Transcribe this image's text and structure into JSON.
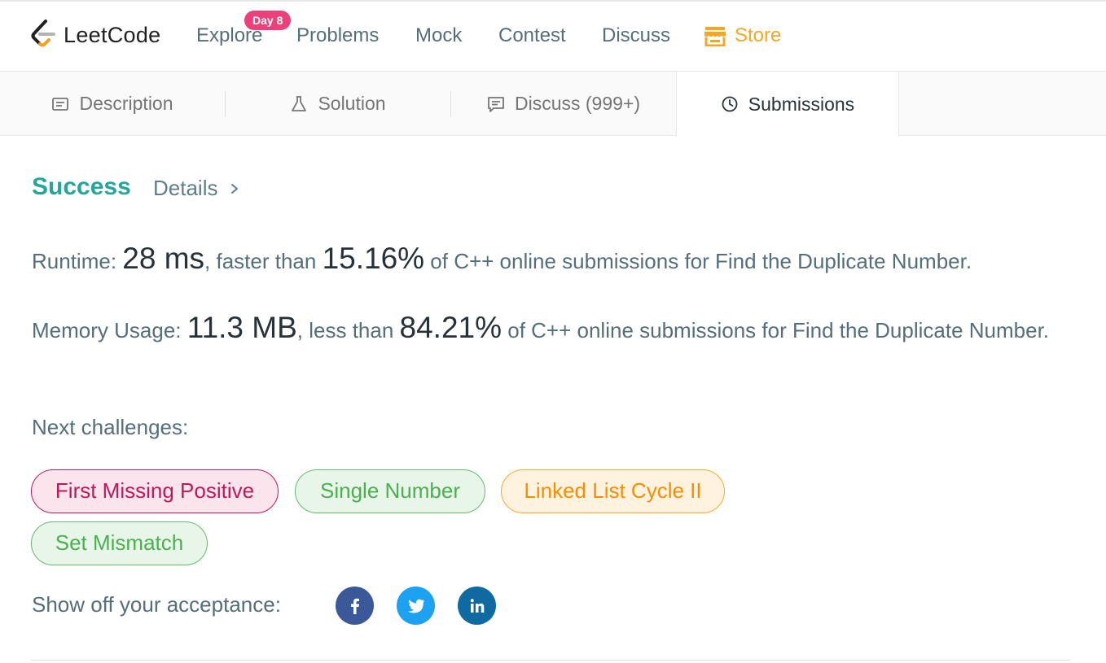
{
  "nav": {
    "logo_text": "LeetCode",
    "items": [
      "Explore",
      "Problems",
      "Mock",
      "Contest",
      "Discuss"
    ],
    "store": "Store",
    "badge": "Day 8"
  },
  "tabs": [
    {
      "label": "Description",
      "icon": "description-icon"
    },
    {
      "label": "Solution",
      "icon": "flask-icon"
    },
    {
      "label": "Discuss (999+)",
      "icon": "comment-icon"
    },
    {
      "label": "Submissions",
      "icon": "clock-icon",
      "active": true
    }
  ],
  "result": {
    "status": "Success",
    "details": "Details",
    "runtime": {
      "label": "Runtime: ",
      "value": "28 ms",
      "mid": ", faster than ",
      "percent": "15.16%",
      "tail": " of C++ online submissions for Find the Duplicate Number."
    },
    "memory": {
      "label": "Memory Usage: ",
      "value": "11.3 MB",
      "mid": ", less than ",
      "percent": "84.21%",
      "tail": " of C++ online submissions for Find the Duplicate Number."
    }
  },
  "next": {
    "label": "Next challenges:",
    "items": [
      "First Missing Positive",
      "Single Number",
      "Linked List Cycle II",
      "Set Mismatch"
    ]
  },
  "share": {
    "label": "Show off your acceptance:",
    "icons": [
      "facebook-icon",
      "twitter-icon",
      "linkedin-icon"
    ]
  },
  "colors": {
    "success": "#26a69a",
    "store": "#f5a623",
    "badge": "#ec407a",
    "chip_hard": "#c2185b",
    "chip_easy": "#4caf50",
    "chip_medium": "#fb8c00"
  }
}
